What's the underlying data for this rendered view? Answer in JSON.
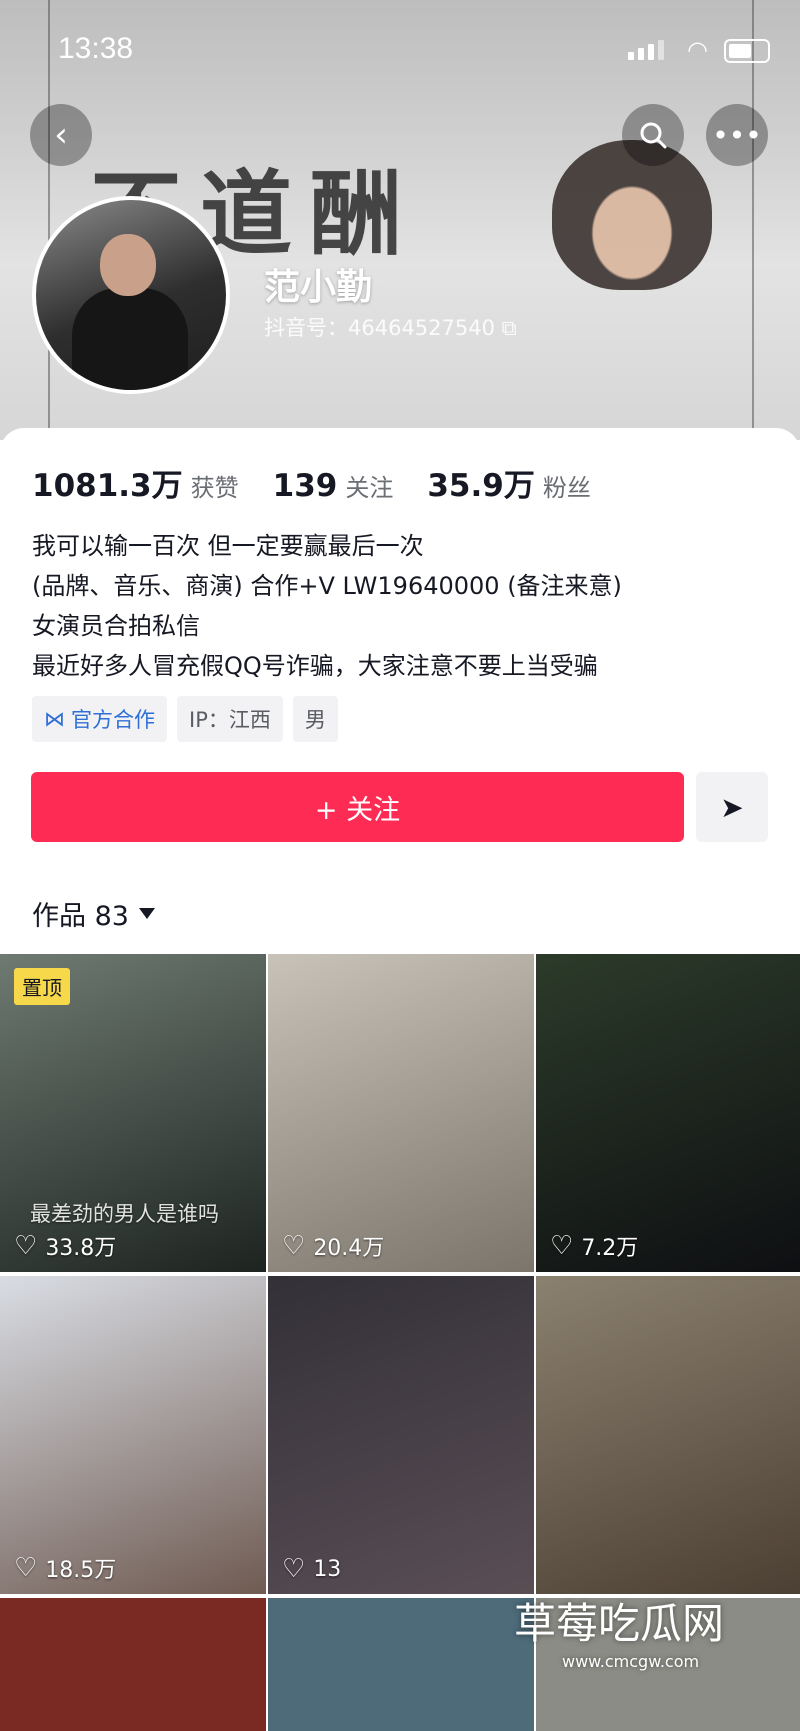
{
  "status_bar": {
    "time": "13:38"
  },
  "header": {
    "back_icon": "chevron-left-icon",
    "search_icon": "search-icon",
    "more_icon": "more-icon",
    "banner_text": "不道酬",
    "name": "范小勤",
    "uid": "抖音号：46464527540"
  },
  "stats": {
    "likes_value": "1081.3万",
    "likes_label": "获赞",
    "following_value": "139",
    "following_label": "关注",
    "followers_value": "35.9万",
    "followers_label": "粉丝"
  },
  "bio": [
    "我可以输一百次 但一定要赢最后一次",
    "(品牌、音乐、商演) 合作+V   LW19640000 (备注来意)",
    "女演员合拍私信",
    "最近好多人冒充假QQ号诈骗，大家注意不要上当受骗"
  ],
  "tags": {
    "official": "官方合作",
    "ip": "IP：江西",
    "gender": "男"
  },
  "actions": {
    "follow_label": "+ 关注",
    "share_icon": "send-icon"
  },
  "works": {
    "label": "作品 83"
  },
  "grid": [
    {
      "pin": "置顶",
      "caption": "最差劲的男人是谁吗",
      "likes": "33.8万",
      "colors": [
        "#6e7a72",
        "#1d2420"
      ]
    },
    {
      "likes": "20.4万",
      "colors": [
        "#c8c3b8",
        "#7b756c"
      ]
    },
    {
      "likes": "7.2万",
      "colors": [
        "#2c3b2a",
        "#0e0f12"
      ]
    },
    {
      "likes": "18.5万",
      "colors": [
        "#d9dde4",
        "#6f5b52"
      ]
    },
    {
      "likes": "13",
      "colors": [
        "#333038",
        "#5a4e55"
      ]
    },
    {
      "likes": "",
      "colors": [
        "#8b8170",
        "#4c3f33"
      ]
    }
  ],
  "watermark": {
    "title": "草莓吃瓜网",
    "url": "www.cmcgw.com"
  }
}
